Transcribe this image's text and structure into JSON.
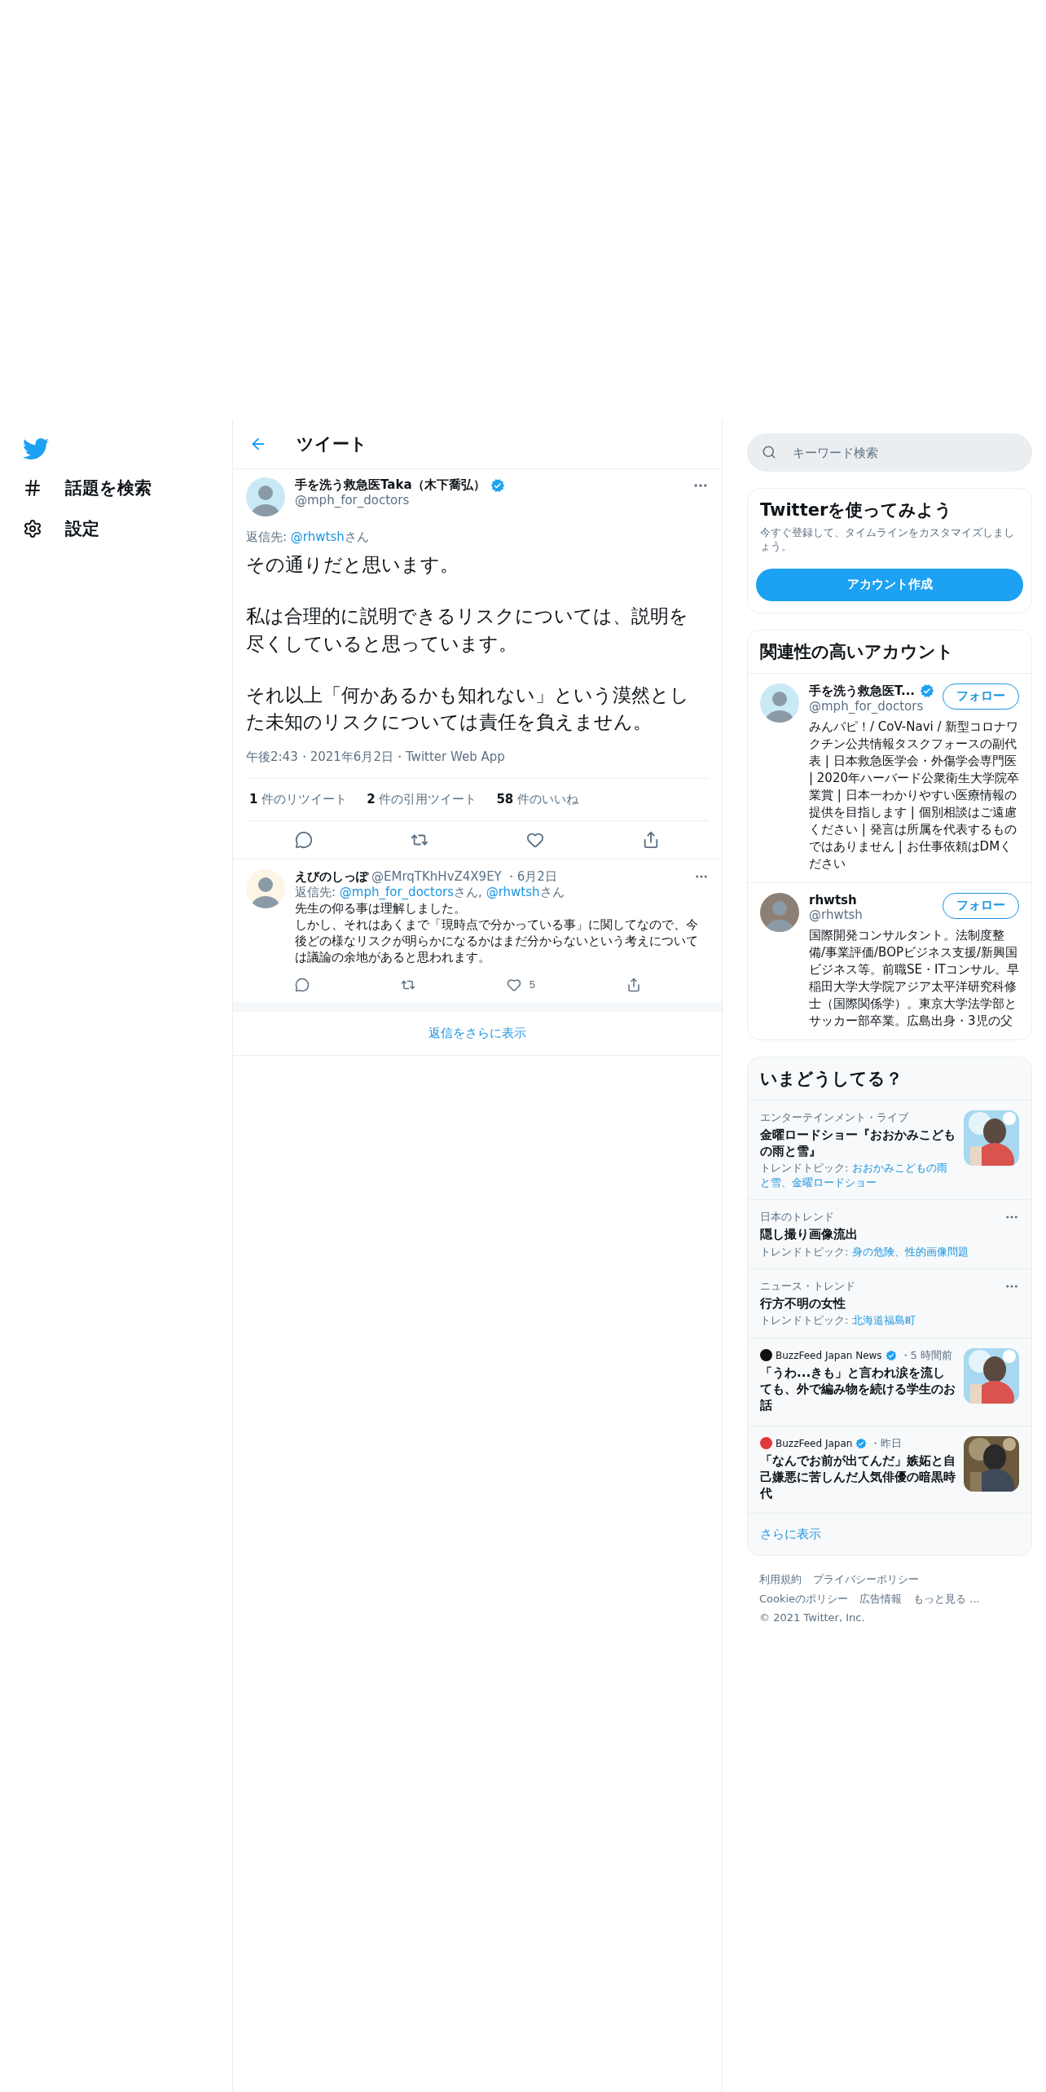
{
  "nav": {
    "items": [
      {
        "kind": "hash",
        "label": "話題を検索"
      },
      {
        "kind": "settings",
        "label": "設定"
      }
    ]
  },
  "header": {
    "title": "ツイート"
  },
  "tweet": {
    "name": "手を洗う救急医Taka（木下喬弘）",
    "handle": "@mph_for_doctors",
    "verified": true,
    "reply_to": {
      "label": "返信先:",
      "mentions": [
        {
          "handle": "@rhwtsh",
          "suffix": "さん"
        }
      ]
    },
    "paragraphs": [
      "その通りだと思います。",
      "私は合理的に説明できるリスクについては、説明を尽くしていると思っています。",
      "それ以上「何かあるかも知れない」という漠然とした未知のリスクについては責任を負えません。"
    ],
    "meta": "午後2:43・2021年6月2日・Twitter Web App",
    "stats": [
      {
        "text": "**1** 件のリツイート"
      },
      {
        "text": "**2** 件の引用ツイート"
      },
      {
        "text": "**58** 件のいいね"
      }
    ]
  },
  "replies": [
    {
      "name": "えびのしっぽ",
      "handle": "@EMrqTKhHvZ4X9EY",
      "date": "・6月2日",
      "reply_to": {
        "label": "返信先:",
        "mentions": [
          {
            "handle": "@mph_for_doctors",
            "suffix": "さん,"
          },
          {
            "handle": "@rhwtsh",
            "suffix": "さん"
          }
        ]
      },
      "lines": [
        "先生の仰る事は理解しました。",
        "しかし、それはあくまで「現時点で分かっている事」に関してなので、今後どの様なリスクが明らかになるかはまだ分からないという考えについては議論の余地があると思われます。"
      ],
      "likes": "5"
    }
  ],
  "show_more_replies": "返信をさらに表示",
  "search": {
    "placeholder": "キーワード検索"
  },
  "signup": {
    "title": "Twitterを使ってみよう",
    "text": "今すぐ登録して、タイムラインをカスタマイズしましょう。",
    "button": "アカウント作成"
  },
  "accounts": {
    "title": "関連性の高いアカウント",
    "items": [
      {
        "name": "手を洗う救急医T...",
        "handle": "@mph_for_doctors",
        "verified": true,
        "button": "フォロー",
        "bio": "みんパピ！/ CoV-Navi / 新型コロナワクチン公共情報タスクフォースの副代表 | 日本救急医学会・外傷学会専門医 | 2020年ハーバード公衆衛生大学院卒業賞 | 日本一わかりやすい医療情報の提供を目指します | 個別相談はご遠慮ください | 発言は所属を代表するものではありません | お仕事依頼はDMください"
      },
      {
        "name": "rhwtsh",
        "handle": "@rhwtsh",
        "verified": false,
        "button": "フォロー",
        "bio": "国際開発コンサルタント。法制度整備/事業評価/BOPビジネス支援/新興国ビジネス等。前職SE・ITコンサル。早稲田大学大学院アジア太平洋研究科修士（国際関係学）。東京大学法学部とサッカー部卒業。広島出身・3児の父"
      }
    ]
  },
  "trends": {
    "title": "いまどうしてる？",
    "items": [
      {
        "kind": "trend",
        "category": "エンターテインメント・ライブ",
        "title": "金曜ロードショー『おおかみこどもの雨と雪』",
        "topic_label": "トレンドトピック:",
        "topics": "おおかみこどもの雨と雪、金曜ロードショー",
        "more": false
      },
      {
        "kind": "trend",
        "category": "日本のトレンド",
        "title": "隠し撮り画像流出",
        "topic_label": "トレンドトピック:",
        "topics": "身の危険、性的画像問題",
        "more": true
      },
      {
        "kind": "trend",
        "category": "ニュース・トレンド",
        "title": "行方不明の女性",
        "topic_label": "トレンドトピック:",
        "topics": "北海道福島町",
        "more": true
      },
      {
        "kind": "news",
        "source": "BuzzFeed Japan News",
        "color": "#111111",
        "verified": true,
        "time": "・5 時間前",
        "title": "「うわ...きも」と言われ涙を流しても、外で編み物を続ける学生のお話"
      },
      {
        "kind": "news",
        "source": "BuzzFeed Japan",
        "color": "#e0393e",
        "verified": true,
        "time": "・昨日",
        "title": "「なんでお前が出てんだ」嫉妬と自己嫌悪に苦しんだ人気俳優の暗黒時代"
      }
    ],
    "more_link": "さらに表示"
  },
  "footer": {
    "links": [
      "利用規約",
      "プライバシーポリシー",
      "Cookieのポリシー",
      "広告情報",
      "もっと見る ..."
    ],
    "copyright": "© 2021 Twitter, Inc."
  }
}
